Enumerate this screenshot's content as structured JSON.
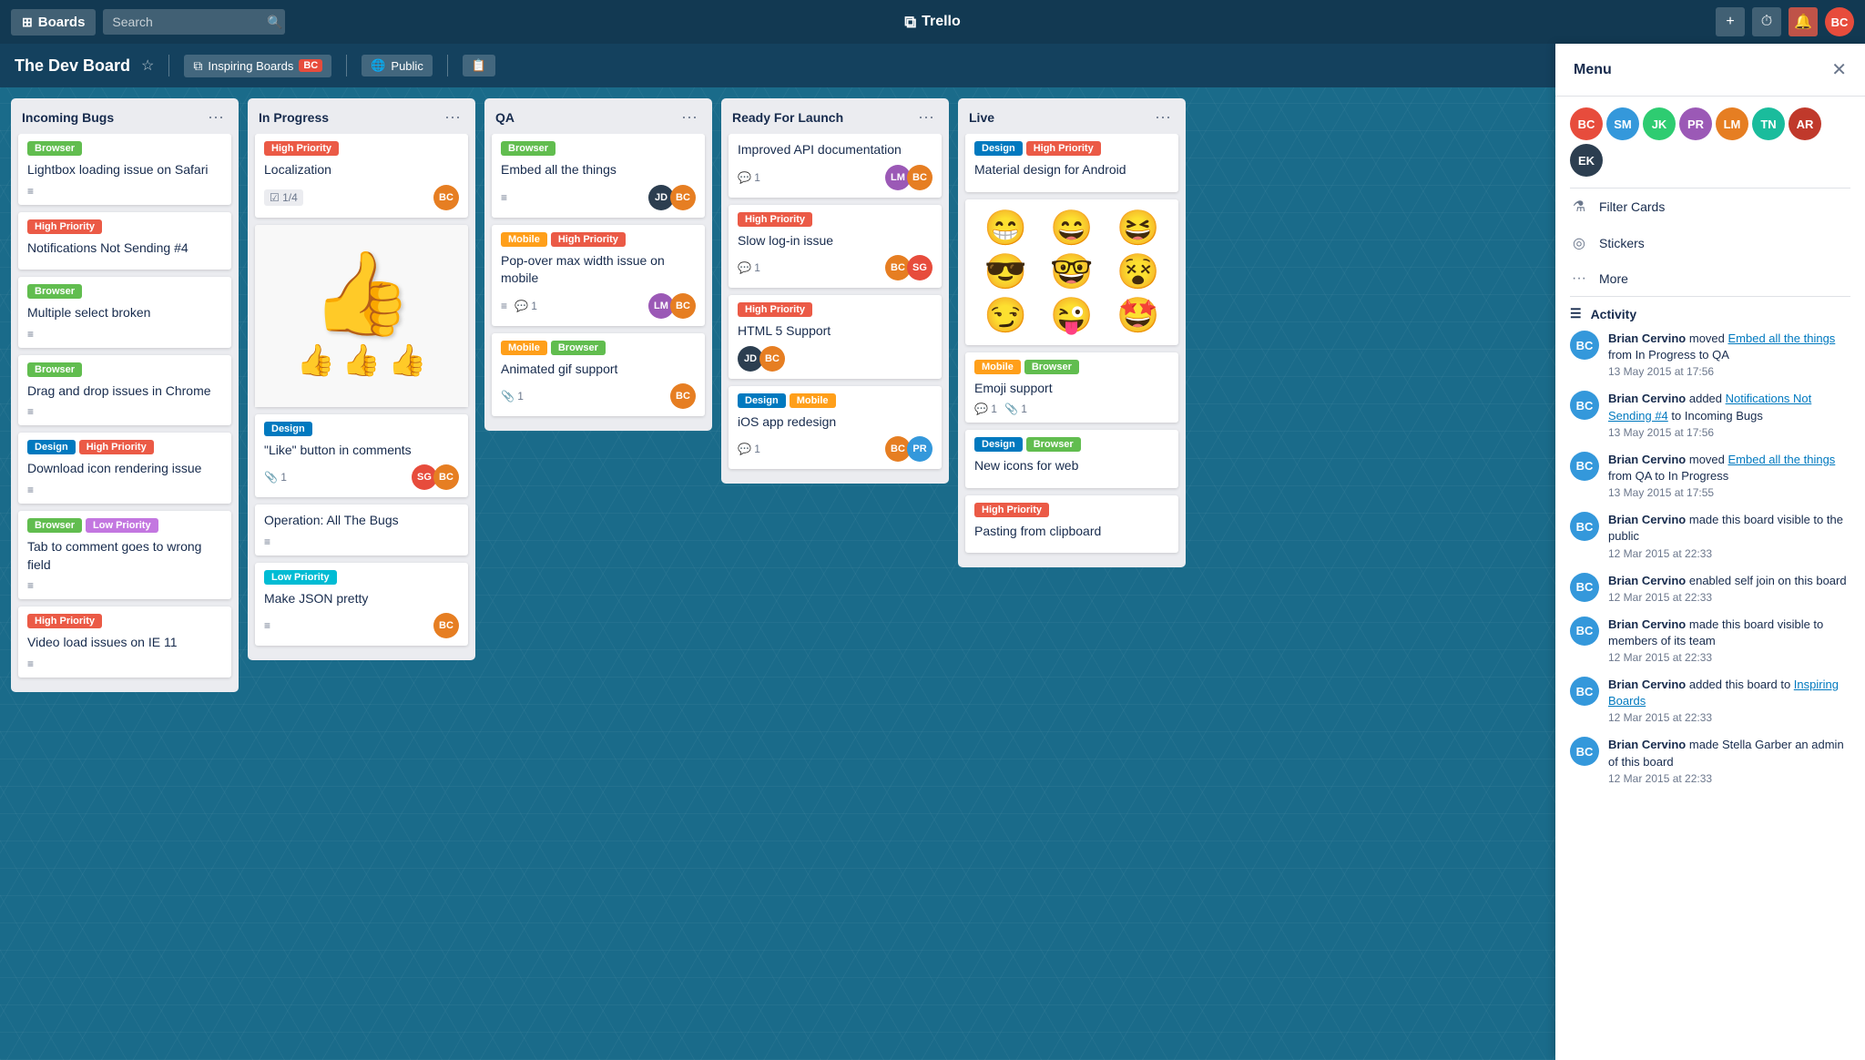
{
  "nav": {
    "boards_label": "Boards",
    "search_placeholder": "Search",
    "trello_label": "Trello",
    "add_title": "+",
    "timer_icon": "⏱",
    "bell_icon": "🔔",
    "user_initials": "BC"
  },
  "board": {
    "title": "The Dev Board",
    "team_label": "Inspiring Boards",
    "team_code": "BC",
    "visibility_label": "Public",
    "share_label": "🔗"
  },
  "lists": [
    {
      "id": "incoming-bugs",
      "title": "Incoming Bugs",
      "cards": [
        {
          "id": "card-1",
          "labels": [
            {
              "type": "browser",
              "text": "Browser"
            }
          ],
          "title": "Lightbox loading issue on Safari",
          "has_description": true,
          "avatars": []
        },
        {
          "id": "card-2",
          "labels": [
            {
              "type": "high-priority",
              "text": "High Priority"
            }
          ],
          "title": "Notifications Not Sending #4",
          "has_description": true,
          "avatars": []
        },
        {
          "id": "card-3",
          "labels": [
            {
              "type": "browser",
              "text": "Browser"
            }
          ],
          "title": "Multiple select broken",
          "has_description": true,
          "avatars": []
        },
        {
          "id": "card-4",
          "labels": [
            {
              "type": "browser",
              "text": "Browser"
            }
          ],
          "title": "Drag and drop issues in Chrome",
          "has_description": true,
          "avatars": []
        },
        {
          "id": "card-5",
          "labels": [
            {
              "type": "design",
              "text": "Design"
            },
            {
              "type": "high-priority",
              "text": "High Priority"
            }
          ],
          "title": "Download icon rendering issue",
          "has_description": true,
          "avatars": []
        },
        {
          "id": "card-6",
          "labels": [
            {
              "type": "browser",
              "text": "Browser"
            },
            {
              "type": "low-priority",
              "text": "Low Priority"
            }
          ],
          "title": "Tab to comment goes to wrong field",
          "has_description": true,
          "avatars": []
        },
        {
          "id": "card-7",
          "labels": [
            {
              "type": "high-priority",
              "text": "High Priority"
            }
          ],
          "title": "Video load issues on IE 11",
          "has_description": true,
          "avatars": []
        }
      ]
    },
    {
      "id": "in-progress",
      "title": "In Progress",
      "cards": [
        {
          "id": "card-8",
          "labels": [
            {
              "type": "high-priority",
              "text": "High Priority"
            }
          ],
          "title": "Localization",
          "progress": "1/4",
          "has_description": false,
          "avatars": [
            "av-orange"
          ]
        },
        {
          "id": "card-9",
          "type": "image-thumbs",
          "labels": [],
          "title": "",
          "has_description": false,
          "avatars": []
        },
        {
          "id": "card-10",
          "labels": [
            {
              "type": "design",
              "text": "Design"
            }
          ],
          "title": "\"Like\" button in comments",
          "pin_count": 1,
          "has_description": false,
          "avatars": [
            "av-red",
            "av-orange"
          ]
        },
        {
          "id": "card-11",
          "labels": [],
          "title": "Operation: All The Bugs",
          "has_description": true,
          "avatars": []
        },
        {
          "id": "card-12",
          "labels": [
            {
              "type": "low-priority-cyan",
              "text": "Low Priority"
            }
          ],
          "title": "Make JSON pretty",
          "has_description": true,
          "avatars": [
            "av-orange"
          ]
        }
      ]
    },
    {
      "id": "qa",
      "title": "QA",
      "cards": [
        {
          "id": "card-13",
          "labels": [
            {
              "type": "browser",
              "text": "Browser"
            }
          ],
          "title": "Embed all the things",
          "has_description": true,
          "avatars": [
            "av-dark",
            "av-orange"
          ]
        },
        {
          "id": "card-14",
          "labels": [
            {
              "type": "mobile",
              "text": "Mobile"
            },
            {
              "type": "high-priority",
              "text": "High Priority"
            }
          ],
          "title": "Pop-over max width issue on mobile",
          "comment_count": 1,
          "has_description": true,
          "avatars": [
            "av-purple",
            "av-orange"
          ]
        },
        {
          "id": "card-15",
          "labels": [
            {
              "type": "mobile",
              "text": "Mobile"
            },
            {
              "type": "browser",
              "text": "Browser"
            }
          ],
          "title": "Animated gif support",
          "pin_count": 1,
          "has_description": false,
          "avatars": [
            "av-orange"
          ]
        }
      ]
    },
    {
      "id": "ready-for-launch",
      "title": "Ready For Launch",
      "cards": [
        {
          "id": "card-16",
          "labels": [],
          "title": "Improved API documentation",
          "comment_count": 1,
          "has_description": false,
          "avatars": [
            "av-purple",
            "av-orange"
          ]
        },
        {
          "id": "card-17",
          "labels": [
            {
              "type": "high-priority",
              "text": "High Priority"
            }
          ],
          "title": "Slow log-in issue",
          "comment_count": 1,
          "has_description": false,
          "avatars": [
            "av-orange",
            "av-red"
          ]
        },
        {
          "id": "card-18",
          "labels": [
            {
              "type": "high-priority",
              "text": "High Priority"
            }
          ],
          "title": "HTML 5 Support",
          "has_description": false,
          "avatars": [
            "av-dark",
            "av-orange"
          ]
        },
        {
          "id": "card-19",
          "labels": [
            {
              "type": "design",
              "text": "Design"
            },
            {
              "type": "mobile",
              "text": "Mobile"
            }
          ],
          "title": "iOS app redesign",
          "comment_count": 1,
          "has_description": false,
          "avatars": [
            "av-orange",
            "av-blue"
          ]
        }
      ]
    },
    {
      "id": "live",
      "title": "Live",
      "cards": [
        {
          "id": "card-20",
          "labels": [
            {
              "type": "design",
              "text": "Design"
            },
            {
              "type": "high-priority",
              "text": "High Priority"
            }
          ],
          "title": "Material design for Android",
          "has_description": false,
          "avatars": []
        },
        {
          "id": "card-21",
          "type": "emoji-grid",
          "labels": [],
          "title": "",
          "has_description": false,
          "avatars": []
        },
        {
          "id": "card-22",
          "labels": [
            {
              "type": "mobile",
              "text": "Mobile"
            },
            {
              "type": "browser",
              "text": "Browser"
            }
          ],
          "title": "Emoji support",
          "comment_count": 1,
          "pin_count": 1,
          "has_description": false,
          "avatars": []
        },
        {
          "id": "card-23",
          "labels": [
            {
              "type": "design",
              "text": "Design"
            },
            {
              "type": "browser",
              "text": "Browser"
            }
          ],
          "title": "New icons for web",
          "has_description": false,
          "avatars": []
        },
        {
          "id": "card-24",
          "labels": [
            {
              "type": "high-priority",
              "text": "High Priority"
            }
          ],
          "title": "Pasting from clipboard",
          "has_description": false,
          "avatars": []
        }
      ]
    }
  ],
  "panel": {
    "title": "Menu",
    "close_label": "✕",
    "filter_cards_label": "Filter Cards",
    "stickers_label": "Stickers",
    "more_label": "More",
    "activity_label": "Activity",
    "members": [
      "BC",
      "SM",
      "JK",
      "PR",
      "LM",
      "TN",
      "AR",
      "EK"
    ]
  },
  "activity": [
    {
      "user": "Brian Cervino",
      "action": "moved",
      "link_text": "Embed all the things",
      "rest": "from In Progress to QA",
      "time": "13 May 2015 at 17:56",
      "initials": "BC"
    },
    {
      "user": "Brian Cervino",
      "action": "added",
      "link_text": "Notifications Not Sending #4",
      "rest": "to Incoming Bugs",
      "time": "13 May 2015 at 17:56",
      "initials": "BC"
    },
    {
      "user": "Brian Cervino",
      "action": "moved",
      "link_text": "Embed all the things",
      "rest": "from QA to In Progress",
      "time": "13 May 2015 at 17:55",
      "initials": "BC"
    },
    {
      "user": "Brian Cervino",
      "action": "made this board visible to the public",
      "link_text": "",
      "rest": "",
      "time": "12 Mar 2015 at 22:33",
      "initials": "BC"
    },
    {
      "user": "Brian Cervino",
      "action": "enabled self join on this board",
      "link_text": "",
      "rest": "",
      "time": "12 Mar 2015 at 22:33",
      "initials": "BC"
    },
    {
      "user": "Brian Cervino",
      "action": "made this board visible to members of its team",
      "link_text": "",
      "rest": "",
      "time": "12 Mar 2015 at 22:33",
      "initials": "BC"
    },
    {
      "user": "Brian Cervino",
      "action": "added this board to",
      "link_text": "Inspiring Boards",
      "rest": "",
      "time": "12 Mar 2015 at 22:33",
      "initials": "BC"
    },
    {
      "user": "Brian Cervino",
      "action": "made Stella Garber an admin of this board",
      "link_text": "",
      "rest": "",
      "time": "12 Mar 2015 at 22:33",
      "initials": "BC"
    }
  ]
}
